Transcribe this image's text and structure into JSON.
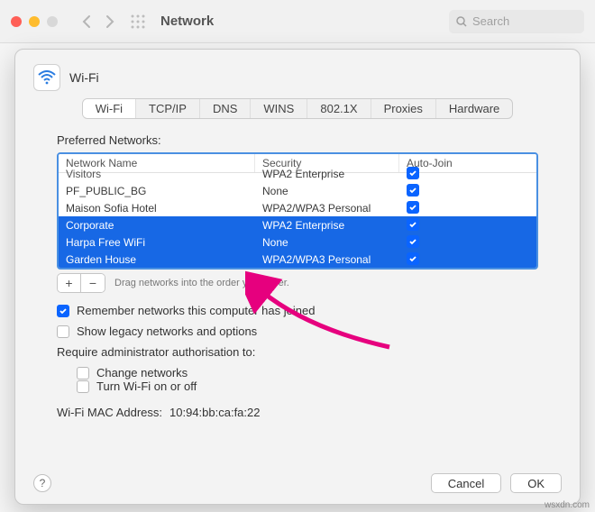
{
  "toolbar": {
    "title": "Network",
    "search_placeholder": "Search"
  },
  "sheet": {
    "title": "Wi-Fi",
    "tabs": [
      "Wi-Fi",
      "TCP/IP",
      "DNS",
      "WINS",
      "802.1X",
      "Proxies",
      "Hardware"
    ],
    "active_tab": 0,
    "preferred_label": "Preferred Networks:",
    "columns": {
      "name": "Network Name",
      "security": "Security",
      "auto": "Auto-Join"
    },
    "rows": [
      {
        "name": "Visitors",
        "security": "WPA2 Enterprise",
        "auto": true,
        "partial": true
      },
      {
        "name": "PF_PUBLIC_BG",
        "security": "None",
        "auto": true
      },
      {
        "name": "Maison Sofia Hotel",
        "security": "WPA2/WPA3 Personal",
        "auto": true
      },
      {
        "name": "Corporate",
        "security": "WPA2 Enterprise",
        "auto": true,
        "selected": true
      },
      {
        "name": "Harpa Free WiFi",
        "security": "None",
        "auto": true,
        "selected": true
      },
      {
        "name": "Garden House",
        "security": "WPA2/WPA3 Personal",
        "auto": true,
        "selected": true
      }
    ],
    "drag_hint": "Drag networks into the order you prefer.",
    "remember_label": "Remember networks this computer has joined",
    "remember_checked": true,
    "legacy_label": "Show legacy networks and options",
    "legacy_checked": false,
    "admin_label": "Require administrator authorisation to:",
    "change_networks_label": "Change networks",
    "change_networks_checked": false,
    "turn_wifi_label": "Turn Wi-Fi on or off",
    "turn_wifi_checked": false,
    "mac_label": "Wi-Fi MAC Address:",
    "mac_value": "10:94:bb:ca:fa:22",
    "help": "?",
    "cancel": "Cancel",
    "ok": "OK"
  },
  "plus": "+",
  "minus": "−",
  "watermark": "wsxdn.com"
}
